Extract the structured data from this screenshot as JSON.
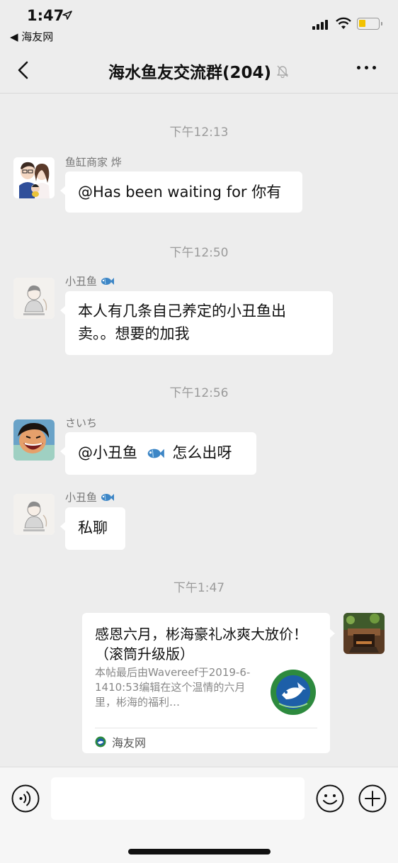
{
  "status_bar": {
    "time": "1:47",
    "location_icon": "location-arrow-icon",
    "back_app": "◀ 海友网",
    "battery_color": "#f2c200"
  },
  "nav": {
    "title": "海水鱼友交流群(204)",
    "mute_icon": "bell-off-icon",
    "more_icon": "more-dots-icon"
  },
  "messages": [
    {
      "type": "timestamp",
      "text": "下午12:13"
    },
    {
      "type": "message",
      "sender": "鱼缸商家 烨",
      "text": "@Has been waiting for 你有"
    },
    {
      "type": "timestamp",
      "text": "下午12:50"
    },
    {
      "type": "message",
      "sender": "小丑鱼",
      "text_line1": "本人有几条自己养定的小丑鱼出",
      "text_line2": "卖。。想要的加我"
    },
    {
      "type": "timestamp",
      "text": "下午12:56"
    },
    {
      "type": "message",
      "sender": "さいち",
      "text_before": "@小丑鱼",
      "text_after": "怎么出呀"
    },
    {
      "type": "message",
      "sender": "小丑鱼",
      "text": "私聊"
    },
    {
      "type": "timestamp",
      "text": "下午1:47"
    },
    {
      "type": "link_card",
      "title": "感恩六月，彬海豪礼冰爽大放价！（滚筒升级版）",
      "description": "本帖最后由Wavereef于2019-6-1410:53编辑在这个温情的六月里，彬海的福利…",
      "source": "海友网"
    }
  ],
  "input_bar": {
    "placeholder": "",
    "voice_icon": "voice-icon",
    "emoji_icon": "emoji-icon",
    "plus_icon": "plus-icon"
  }
}
